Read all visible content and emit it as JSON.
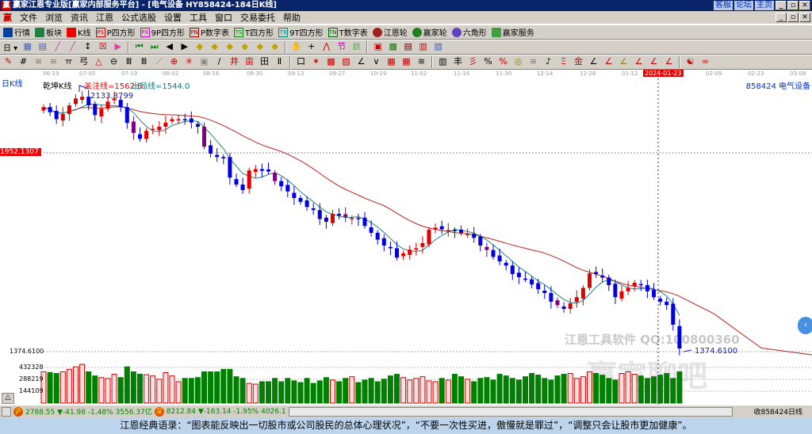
{
  "window": {
    "title": "赢家江恩专业版[赢家内部服务平台] - [电气设备   HY858424-184日K线]",
    "logo": "赢",
    "links": [
      "客服",
      "论坛",
      "主页"
    ]
  },
  "menu": [
    "文件",
    "浏览",
    "资讯",
    "江恩",
    "公式选股",
    "设置",
    "工具",
    "窗口",
    "交易委托",
    "帮助"
  ],
  "toolbar1": [
    {
      "icon": "quote-icon",
      "label": "行情",
      "c": "#0040a0"
    },
    {
      "icon": "sector-icon",
      "label": "板块",
      "c": "#208040"
    },
    {
      "icon": "kline-icon",
      "label": "K线",
      "c": "#e00"
    },
    {
      "icon": "p-square-icon",
      "tag": "PS",
      "label": "P四方形",
      "c": "#c00"
    },
    {
      "icon": "9p-square-icon",
      "tag": "P9",
      "label": "9P四方形",
      "c": "#c0c"
    },
    {
      "icon": "p-table-icon",
      "tag": "PN",
      "label": "P数字表",
      "c": "#a00"
    },
    {
      "icon": "t-square-icon",
      "tag": "TS",
      "label": "T四方形",
      "c": "#080"
    },
    {
      "icon": "9t-square-icon",
      "tag": "T9",
      "label": "9T四方形",
      "c": "#088"
    },
    {
      "icon": "t-table-icon",
      "tag": "TN",
      "label": "T数字表",
      "c": "#060"
    },
    {
      "icon": "gann-wheel-icon",
      "label": "江恩轮",
      "c": "#a02020"
    },
    {
      "icon": "winner-wheel-icon",
      "label": "赢家轮",
      "c": "#208020"
    },
    {
      "icon": "hexagon-icon",
      "label": "六角形",
      "c": "#6040c0"
    },
    {
      "icon": "service-icon",
      "label": "赢家服务",
      "c": "#40a040"
    }
  ],
  "period": "日",
  "chart": {
    "header_left": "日K线",
    "indicator": "乾坤K线",
    "focus_line": "关注线=1562.6",
    "exit_line": "出局线=1544.0",
    "high_label": "2133.8799",
    "low_label": "1374.6100",
    "cursor_price": "1952.1307",
    "axis_low": "1374.6100",
    "right_label": "858424 电气设备",
    "dates": [
      "06-19",
      "07-05",
      "07-19",
      "08-02",
      "08-16",
      "08-30",
      "09-13",
      "09-27",
      "10-19",
      "11-02",
      "11-16",
      "11-30",
      "12-14",
      "12-28",
      "01-12",
      "2024-01-23",
      "02-09",
      "02-23",
      "03-08"
    ],
    "cursor_date": "2024-01-23",
    "vol_ticks": [
      "432328",
      "288219",
      "144109"
    ],
    "watermark": "江恩工具软件  QQ:100800360",
    "watermark2": "赢家聊吧"
  },
  "chart_data": {
    "type": "candlestick",
    "price_range": [
      1374.61,
      2133.88
    ],
    "closes": [
      2085,
      2070,
      2050,
      2065,
      2090,
      2110,
      2115,
      2090,
      2062,
      2080,
      2101,
      2110,
      2085,
      2039,
      2010,
      1993,
      2016,
      2022,
      2028,
      2040,
      2050,
      2050,
      2048,
      2040,
      2028,
      1970,
      1950,
      1940,
      1936,
      1880,
      1860,
      1844,
      1901,
      1905,
      1900,
      1898,
      1870,
      1855,
      1840,
      1821,
      1810,
      1795,
      1786,
      1760,
      1752,
      1775,
      1770,
      1765,
      1763,
      1760,
      1740,
      1720,
      1700,
      1683,
      1675,
      1648,
      1660,
      1671,
      1675,
      1690,
      1729,
      1735,
      1730,
      1728,
      1725,
      1720,
      1717,
      1705,
      1683,
      1670,
      1650,
      1637,
      1625,
      1600,
      1591,
      1585,
      1570,
      1556,
      1545,
      1520,
      1510,
      1499,
      1515,
      1533,
      1560,
      1602,
      1600,
      1590,
      1568,
      1533,
      1550,
      1560,
      1575,
      1568,
      1550,
      1533,
      1520,
      1510,
      1453,
      1384
    ],
    "volumes": [
      380,
      370,
      360,
      380,
      410,
      440,
      470,
      380,
      330,
      310,
      300,
      350,
      310,
      440,
      380,
      350,
      345,
      330,
      290,
      370,
      330,
      260,
      300,
      300,
      310,
      380,
      380,
      380,
      410,
      410,
      320,
      300,
      240,
      230,
      260,
      260,
      300,
      260,
      300,
      270,
      250,
      300,
      240,
      270,
      310,
      280,
      260,
      300,
      320,
      250,
      280,
      300,
      260,
      290,
      330,
      350,
      310,
      280,
      300,
      320,
      270,
      260,
      300,
      280,
      350,
      320,
      290,
      260,
      300,
      310,
      280,
      350,
      330,
      300,
      280,
      320,
      360,
      340,
      300,
      280,
      330,
      350,
      360,
      300,
      320,
      380,
      360,
      340,
      300,
      280,
      360,
      380,
      350,
      330,
      300,
      320,
      340,
      360,
      300,
      380
    ],
    "volume_unit": "thousand",
    "volume_ticks": [
      144109,
      288219,
      432328
    ]
  },
  "status": {
    "sh_label": "沪",
    "sh": "2788.55 ▼-41.98 -1.48% 3556.37亿",
    "sz_label": "深",
    "sz": "8212.84 ▼-163.14 -1.95% 4026.1",
    "right": "收858424日线"
  },
  "quote": "江恩经典语录：“图表能反映出一切股市或公司股民的总体心理状况”，“不要一次性买进，傲慢就是罪过”，“调整只会让股市更加健康”。"
}
